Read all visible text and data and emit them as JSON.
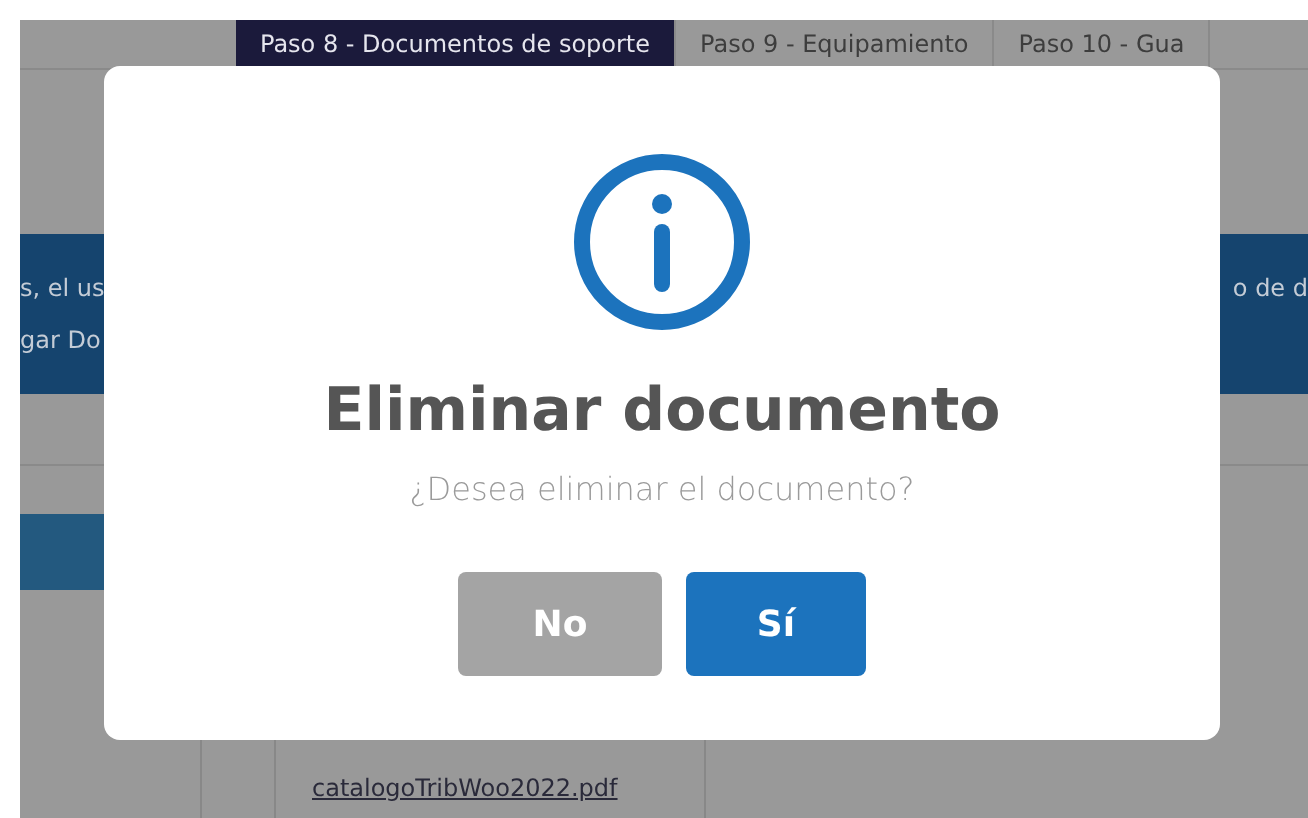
{
  "tabs": [
    {
      "label": "Paso 8 - Documentos de soporte",
      "selected": true
    },
    {
      "label": "Paso 9 - Equipamiento",
      "selected": false
    },
    {
      "label": "Paso 10 - Gua",
      "selected": false
    }
  ],
  "banner": {
    "left_lines": [
      "s, el us",
      "gar Do"
    ],
    "right_lines": [
      "o de d"
    ]
  },
  "document_link": "catalogoTribWoo2022.pdf",
  "dialog": {
    "title": "Eliminar documento",
    "message": "¿Desea eliminar el documento?",
    "buttons": [
      {
        "label": "No",
        "kind": "cancel"
      },
      {
        "label": "Sí",
        "kind": "confirm"
      }
    ]
  }
}
